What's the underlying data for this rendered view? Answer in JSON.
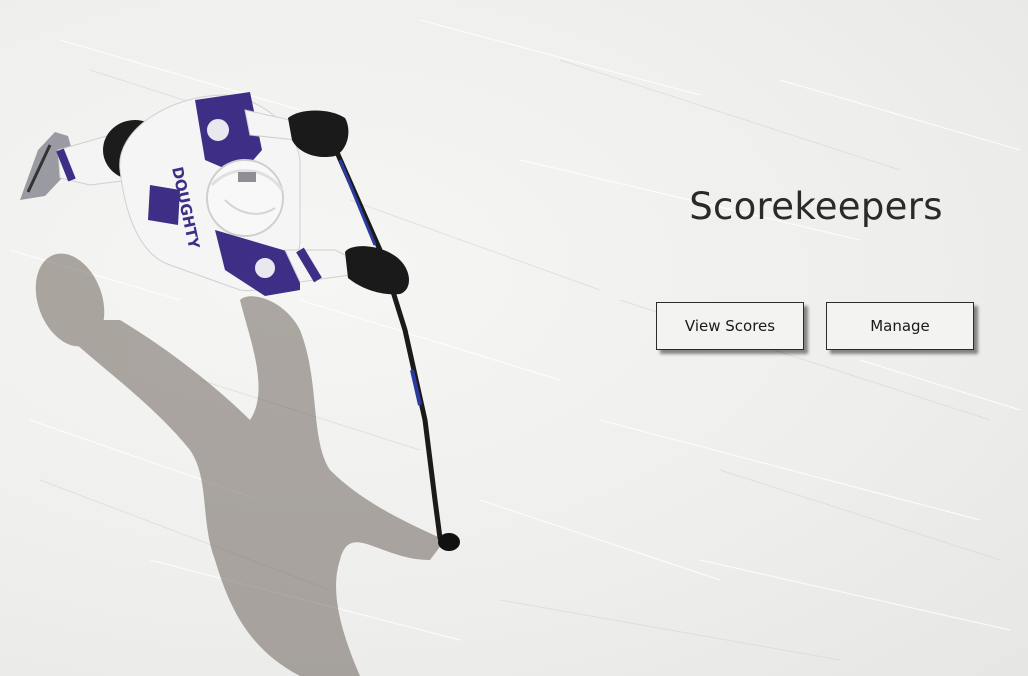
{
  "hero": {
    "title": "Scorekeepers",
    "jersey_name": "DOUGHTY"
  },
  "actions": {
    "view_scores_label": "View Scores",
    "manage_label": "Manage"
  },
  "colors": {
    "ice": "#efefed",
    "jersey_purple": "#3e2e86",
    "text": "#2a2a2a",
    "button_border": "#2b2b2b"
  },
  "icons": {
    "player_image": "hockey-player-overhead-photo"
  }
}
